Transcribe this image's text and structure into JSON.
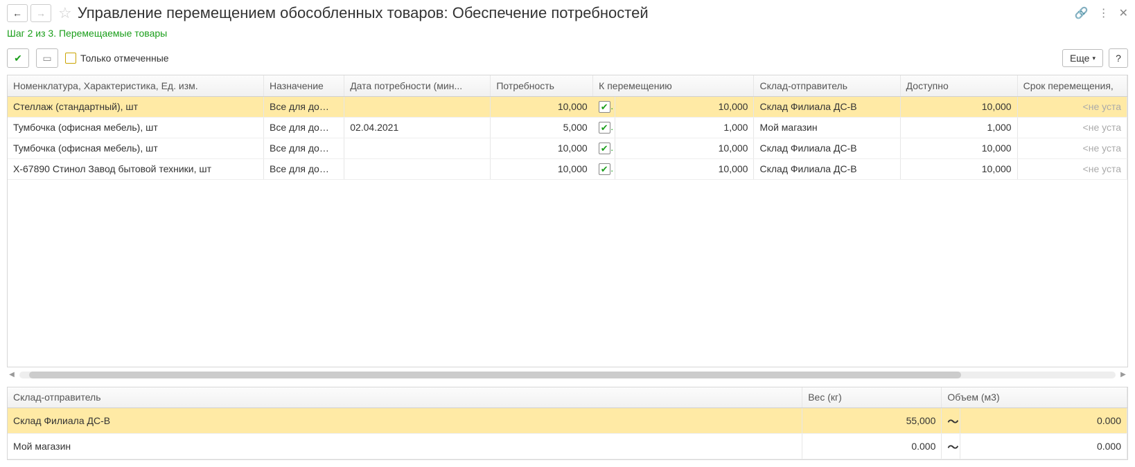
{
  "title": "Управление перемещением обособленных товаров: Обеспечение потребностей",
  "step_line": "Шаг 2 из 3. Перемещаемые товары",
  "toolbar": {
    "only_marked_label": "Только отмеченные",
    "more_label": "Еще",
    "help_label": "?"
  },
  "grid": {
    "columns": {
      "c0": "Номенклатура, Характеристика, Ед. изм.",
      "c1": "Назначение",
      "c2": "Дата потребности (мин...",
      "c3": "Потребность",
      "c4": "К перемещению",
      "c5": "Склад-отправитель",
      "c6": "Доступно",
      "c7": "Срок перемещения,"
    },
    "rows": [
      {
        "selected": true,
        "nom": "Стеллаж (стандартный), шт",
        "nazn": "Все для до…",
        "date": "",
        "potr": "10,000",
        "kper": "10,000",
        "sklad": "Склад Филиала ДС-В",
        "dost": "10,000",
        "srok": "<не уста"
      },
      {
        "selected": false,
        "nom": "Тумбочка (офисная мебель), шт",
        "nazn": "Все для до…",
        "date": "02.04.2021",
        "potr": "5,000",
        "kper": "1,000",
        "sklad": "Мой магазин",
        "dost": "1,000",
        "srok": "<не уста"
      },
      {
        "selected": false,
        "nom": "Тумбочка (офисная мебель), шт",
        "nazn": "Все для до…",
        "date": "",
        "potr": "10,000",
        "kper": "10,000",
        "sklad": "Склад Филиала ДС-В",
        "dost": "10,000",
        "srok": "<не уста"
      },
      {
        "selected": false,
        "nom": "Х-67890 Стинол Завод бытовой техники, шт",
        "nazn": "Все для до…",
        "date": "",
        "potr": "10,000",
        "kper": "10,000",
        "sklad": "Склад Филиала ДС-В",
        "dost": "10,000",
        "srok": "<не уста"
      }
    ]
  },
  "summary": {
    "columns": {
      "c0": "Склад-отправитель",
      "c1": "Вес (кг)",
      "c2": "Объем (м3)"
    },
    "rows": [
      {
        "selected": true,
        "sklad": "Склад Филиала ДС-В",
        "ves": "55,000",
        "vol": "0.000"
      },
      {
        "selected": false,
        "sklad": "Мой магазин",
        "ves": "0.000",
        "vol": "0.000"
      }
    ]
  }
}
